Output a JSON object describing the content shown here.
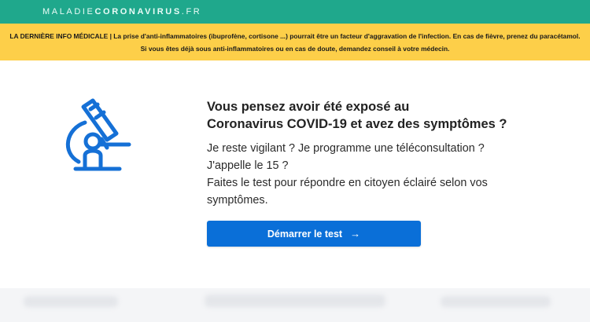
{
  "header": {
    "brand_light": "MALADIE",
    "brand_strong": "CORONAVIRUS",
    "brand_suffix": ".FR",
    "background_color": "#1fa88c"
  },
  "alert": {
    "line1": "LA DERNIÈRE INFO MÉDICALE | La prise d'anti-inflammatoires (ibuprofène, cortisone ...) pourrait être un facteur d'aggravation de l'infection. En cas de fièvre, prenez du paracétamol.",
    "line2": "Si vous êtes déjà sous anti-inflammatoires ou en cas de doute, demandez conseil à votre médecin.",
    "background_color": "#fdcf49"
  },
  "main": {
    "illustration_icon": "microscope-icon",
    "headline_line1": "Vous pensez avoir été exposé au",
    "headline_line2": "Coronavirus COVID-19 et avez des symptômes ?",
    "body_line1": "Je reste vigilant ? Je programme une téléconsultation ?",
    "body_line2": "J'appelle le 15 ?",
    "body_line3": "Faites le test pour répondre en citoyen éclairé selon vos",
    "body_line4": "symptômes.",
    "cta_label": "Démarrer le test",
    "cta_icon": "arrow-right-icon",
    "accent_color": "#0a6fd8"
  }
}
